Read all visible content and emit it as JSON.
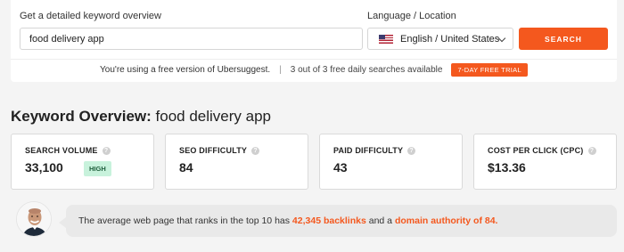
{
  "search": {
    "keyword_label": "Get a detailed keyword overview",
    "keyword_value": "food delivery app",
    "location_label": "Language / Location",
    "location_value": "English / United States",
    "search_button": "SEARCH"
  },
  "free_notice": {
    "text": "You're using a free version of Ubersuggest.",
    "separator": "|",
    "used": "3",
    "out_of": "out of",
    "total": "3",
    "suffix": "free daily searches available",
    "trial_label": "7-DAY FREE TRIAL"
  },
  "overview": {
    "title_prefix": "Keyword Overview:",
    "title_keyword": "food delivery app"
  },
  "metrics": [
    {
      "label": "SEARCH VOLUME",
      "value": "33,100",
      "badge": "HIGH"
    },
    {
      "label": "SEO DIFFICULTY",
      "value": "84"
    },
    {
      "label": "PAID DIFFICULTY",
      "value": "43"
    },
    {
      "label": "COST PER CLICK (CPC)",
      "value": "$13.36"
    }
  ],
  "tip": {
    "before": "The average web page that ranks in the top 10 has",
    "backlinks": "42,345 backlinks",
    "middle": "and a",
    "authority": "domain authority of 84."
  },
  "icons": {
    "info": "info-icon",
    "flag": "us-flag-icon",
    "dropdown": "chevron-down-icon"
  },
  "colors": {
    "accent": "#f4581e",
    "high_badge_bg": "#c8f2dc"
  }
}
